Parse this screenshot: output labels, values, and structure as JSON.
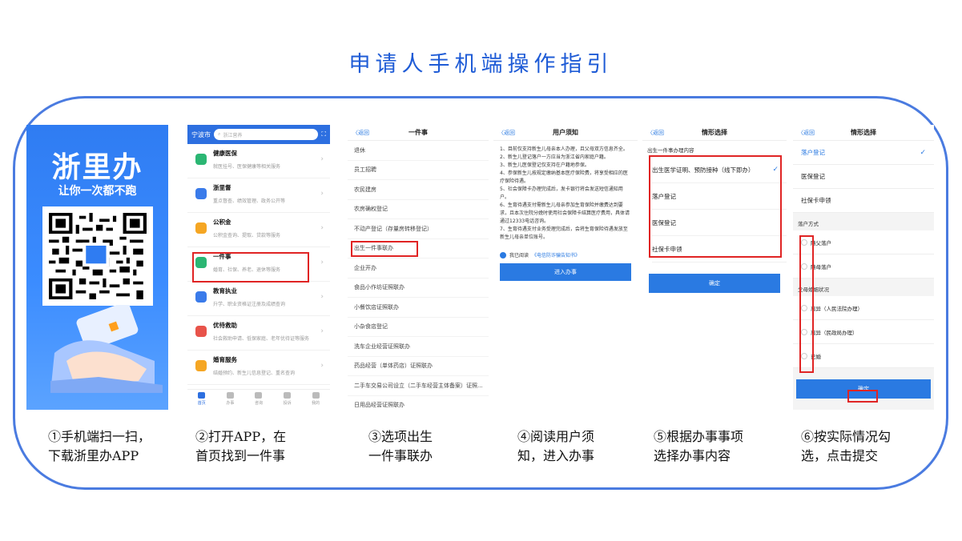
{
  "title": "申请人手机端操作指引",
  "shot1": {
    "logo": "浙里办",
    "slogan": "让你一次都不跑"
  },
  "shot2": {
    "city": "宁波市",
    "search_placeholder": "浙江营养",
    "services": [
      {
        "name": "健康医保",
        "desc": "就医挂号、医保健康等相关服务",
        "color": "#2bb673"
      },
      {
        "name": "浙里督",
        "desc": "重点督查、绩效管理、政务公开等",
        "color": "#3a7bea"
      },
      {
        "name": "公积金",
        "desc": "公积金查询、提取、贷款等服务",
        "color": "#f5a623"
      },
      {
        "name": "一件事",
        "desc": "婚育、社保、养老、退休等服务",
        "color": "#2bb673"
      },
      {
        "name": "教育执业",
        "desc": "升学、职业资格证注册及成绩查询",
        "color": "#3a7bea"
      },
      {
        "name": "优待救助",
        "desc": "社会救助申请、低保家庭、老年优待证等服务",
        "color": "#e8534a"
      },
      {
        "name": "婚育服务",
        "desc": "结婚预约、新生儿信息登记、重名查询",
        "color": "#f5a623"
      }
    ],
    "tabs": [
      "首页",
      "办事",
      "咨询",
      "投诉",
      "我的"
    ]
  },
  "shot3": {
    "back": "返回",
    "title": "一件事",
    "items": [
      "退休",
      "员工招聘",
      "农民建房",
      "农房确权登记",
      "不动产登记（存量房转移登记）",
      "出生一件事联办",
      "企业开办",
      "食品小作坊证照联办",
      "小餐饮店证照联办",
      "小杂食店登记",
      "洗车企业经营证照联办",
      "药品经营（单体药店）证照联办",
      "二手车交易公司设立（二手车经营主体备案）证照...",
      "日用品经营证照联办"
    ]
  },
  "shot4": {
    "back": "返回",
    "title": "用户须知",
    "lines": [
      "1、目前仅支持新生儿母亲本人办理，且父母双方信息齐全。",
      "2、新生儿登记落户一方应当为浙江省内家庭户籍。",
      "3、新生儿医保登记仅支持在户籍地参保。",
      "4、参保新生儿按规定缴纳基本医疗保险费，将享受相应的医疗保险待遇。",
      "5、社会保障卡办理完成后，发卡银行将会发送短信通知用户。",
      "6、生育待遇支付需新生儿母亲参加生育保险并缴费达到要求，且本次住院分娩时使用社会保障卡结算医疗费用，具体请通过12333电话咨询。",
      "7、生育待遇支付业务受理完成后，会将生育保险待遇发放至新生儿母亲单位账号。"
    ],
    "agree_prefix": "我已阅读",
    "agree_link": "《电信防诈骗告知书》",
    "button": "进入办事"
  },
  "shot5": {
    "back": "返回",
    "title": "情形选择",
    "section": "出生一件事办理内容",
    "options": [
      "出生医学证明、预防接种（线下即办）",
      "落户登记",
      "医保登记",
      "社保卡申领"
    ],
    "button": "确定"
  },
  "shot6": {
    "back": "返回",
    "title": "情形选择",
    "options": [
      "落户登记",
      "医保登记",
      "社保卡申领"
    ],
    "group1": "落户方式",
    "group1_items": [
      "随父落户",
      "随母落户"
    ],
    "group2": "父母婚姻状况",
    "group2_items": [
      "离异（人民法院办理）",
      "离异（民政局办理）",
      "已婚"
    ],
    "button": "确定"
  },
  "captions": [
    {
      "l1": "①手机端扫一扫，",
      "l2": "下载浙里办APP"
    },
    {
      "l1": "②打开APP，在",
      "l2": "首页找到一件事"
    },
    {
      "l1": "③选项出生",
      "l2": "一件事联办"
    },
    {
      "l1": "④阅读用户须",
      "l2": "知，进入办事"
    },
    {
      "l1": "⑤根据办事事项",
      "l2": "选择办事内容"
    },
    {
      "l1": "⑥按实际情况勾",
      "l2": "选，点击提交"
    }
  ],
  "colors": {
    "title": "#1e5bd6",
    "frame": "#4a7be0",
    "highlight": "#e02424",
    "primary": "#2a7ae2"
  }
}
